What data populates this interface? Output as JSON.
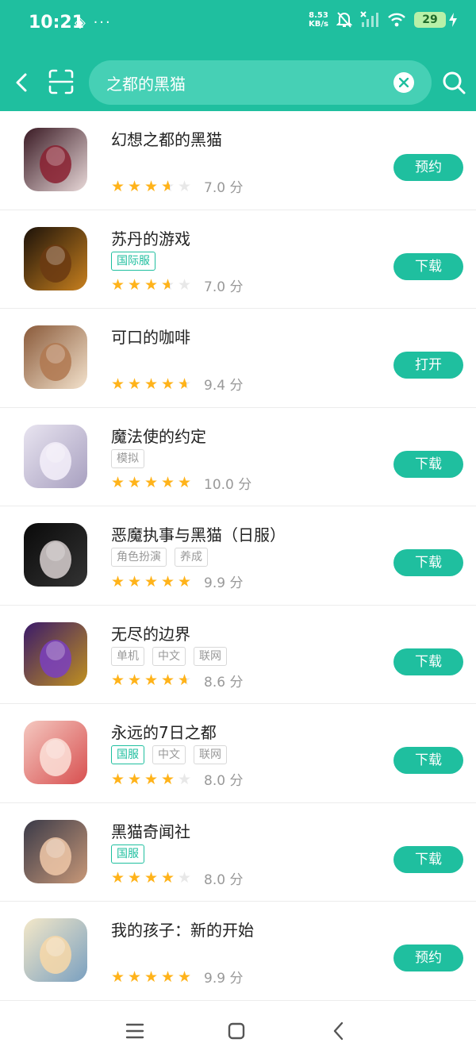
{
  "colors": {
    "accent": "#1fbf9f",
    "star": "#ffb31a"
  },
  "status_bar": {
    "time": "10:21",
    "extra_icons": "◈ ···",
    "net_speed_value": "8.53",
    "net_speed_unit": "KB/s",
    "battery": "29"
  },
  "search": {
    "query": "之都的黑猫"
  },
  "results": [
    {
      "name": "幻想之都的黑猫",
      "tags": [],
      "rating": 3.5,
      "score": "7.0 分",
      "action": "预约"
    },
    {
      "name": "苏丹的游戏",
      "tags": [
        {
          "label": "国际服",
          "highlight": true
        }
      ],
      "rating": 3.5,
      "score": "7.0 分",
      "action": "下载"
    },
    {
      "name": "可口的咖啡",
      "tags": [],
      "rating": 4.5,
      "score": "9.4 分",
      "action": "打开"
    },
    {
      "name": "魔法使的约定",
      "tags": [
        {
          "label": "模拟",
          "highlight": false
        }
      ],
      "rating": 5,
      "score": "10.0 分",
      "action": "下载"
    },
    {
      "name": "恶魔执事与黑猫（日服）",
      "tags": [
        {
          "label": "角色扮演",
          "highlight": false
        },
        {
          "label": "养成",
          "highlight": false
        }
      ],
      "rating": 5,
      "score": "9.9 分",
      "action": "下载"
    },
    {
      "name": "无尽的边界",
      "tags": [
        {
          "label": "单机",
          "highlight": false
        },
        {
          "label": "中文",
          "highlight": false
        },
        {
          "label": "联网",
          "highlight": false
        }
      ],
      "rating": 4.5,
      "score": "8.6 分",
      "action": "下载"
    },
    {
      "name": "永远的7日之都",
      "tags": [
        {
          "label": "国服",
          "highlight": true
        },
        {
          "label": "中文",
          "highlight": false
        },
        {
          "label": "联网",
          "highlight": false
        }
      ],
      "rating": 4,
      "score": "8.0 分",
      "action": "下载"
    },
    {
      "name": "黑猫奇闻社",
      "tags": [
        {
          "label": "国服",
          "highlight": true
        }
      ],
      "rating": 4,
      "score": "8.0 分",
      "action": "下载"
    },
    {
      "name": "我的孩子：新的开始",
      "tags": [],
      "rating": 5,
      "score": "9.9 分",
      "action": "预约"
    }
  ]
}
